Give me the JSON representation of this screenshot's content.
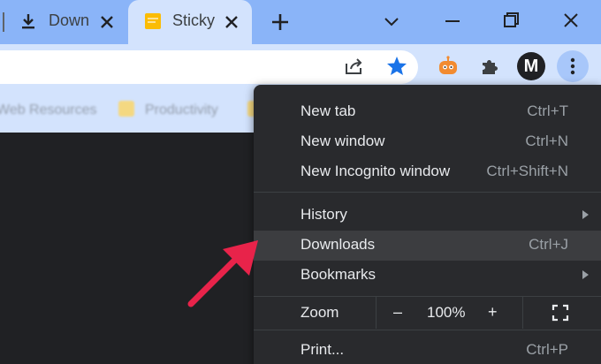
{
  "tabs": [
    {
      "title": "Downloads",
      "icon": "download-icon"
    },
    {
      "title": "Sticky Notes",
      "icon": "sticky-note-icon",
      "active": true
    }
  ],
  "toolbar": {
    "icons": [
      "share-icon",
      "bookmark-star-icon",
      "extension-robot-icon",
      "extensions-puzzle-icon",
      "profile-avatar-icon",
      "more-menu-icon"
    ],
    "profile_initial": "M",
    "star_color": "#1a73e8"
  },
  "bookmarks": [
    {
      "label": "Web Resources"
    },
    {
      "label": "Productivity"
    }
  ],
  "menu": {
    "new_tab": {
      "label": "New tab",
      "shortcut": "Ctrl+T"
    },
    "new_window": {
      "label": "New window",
      "shortcut": "Ctrl+N"
    },
    "new_incognito": {
      "label": "New Incognito window",
      "shortcut": "Ctrl+Shift+N"
    },
    "history": {
      "label": "History"
    },
    "downloads": {
      "label": "Downloads",
      "shortcut": "Ctrl+J"
    },
    "bookmarks": {
      "label": "Bookmarks"
    },
    "zoom": {
      "label": "Zoom",
      "minus": "–",
      "value": "100%",
      "plus": "+"
    },
    "print": {
      "label": "Print...",
      "shortcut": "Ctrl+P"
    }
  },
  "annotation": {
    "arrow_color": "#e8234a"
  }
}
